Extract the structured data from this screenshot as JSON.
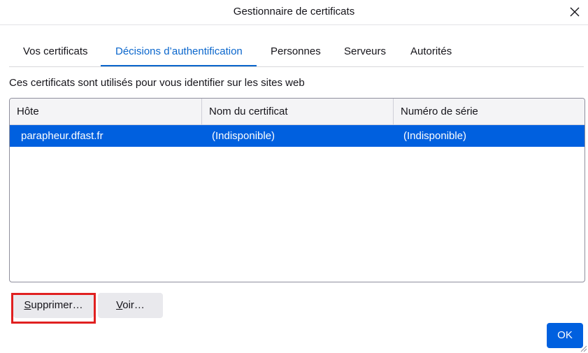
{
  "dialog": {
    "title": "Gestionnaire de certificats"
  },
  "tabs": [
    {
      "label": "Vos certificats",
      "active": false
    },
    {
      "label": "Décisions d’authentification",
      "active": true
    },
    {
      "label": "Personnes",
      "active": false
    },
    {
      "label": "Serveurs",
      "active": false
    },
    {
      "label": "Autorités",
      "active": false
    }
  ],
  "description": "Ces certificats sont utilisés pour vous identifier sur les sites web",
  "table": {
    "columns": [
      "Hôte",
      "Nom du certificat",
      "Numéro de série"
    ],
    "rows": [
      {
        "host": "parapheur.dfast.fr",
        "cert_name": "(Indisponible)",
        "serial": "(Indisponible)",
        "selected": true
      }
    ]
  },
  "buttons": {
    "delete": {
      "accesskey": "S",
      "rest": "upprimer…"
    },
    "view": {
      "accesskey": "V",
      "rest": "oir…"
    },
    "ok": "OK"
  },
  "colors": {
    "accent": "#0060df",
    "active_tab": "#0a66cc",
    "highlight_box": "#e02020"
  },
  "icons": {
    "close": "close-icon",
    "resize": "resize-grip-icon"
  }
}
